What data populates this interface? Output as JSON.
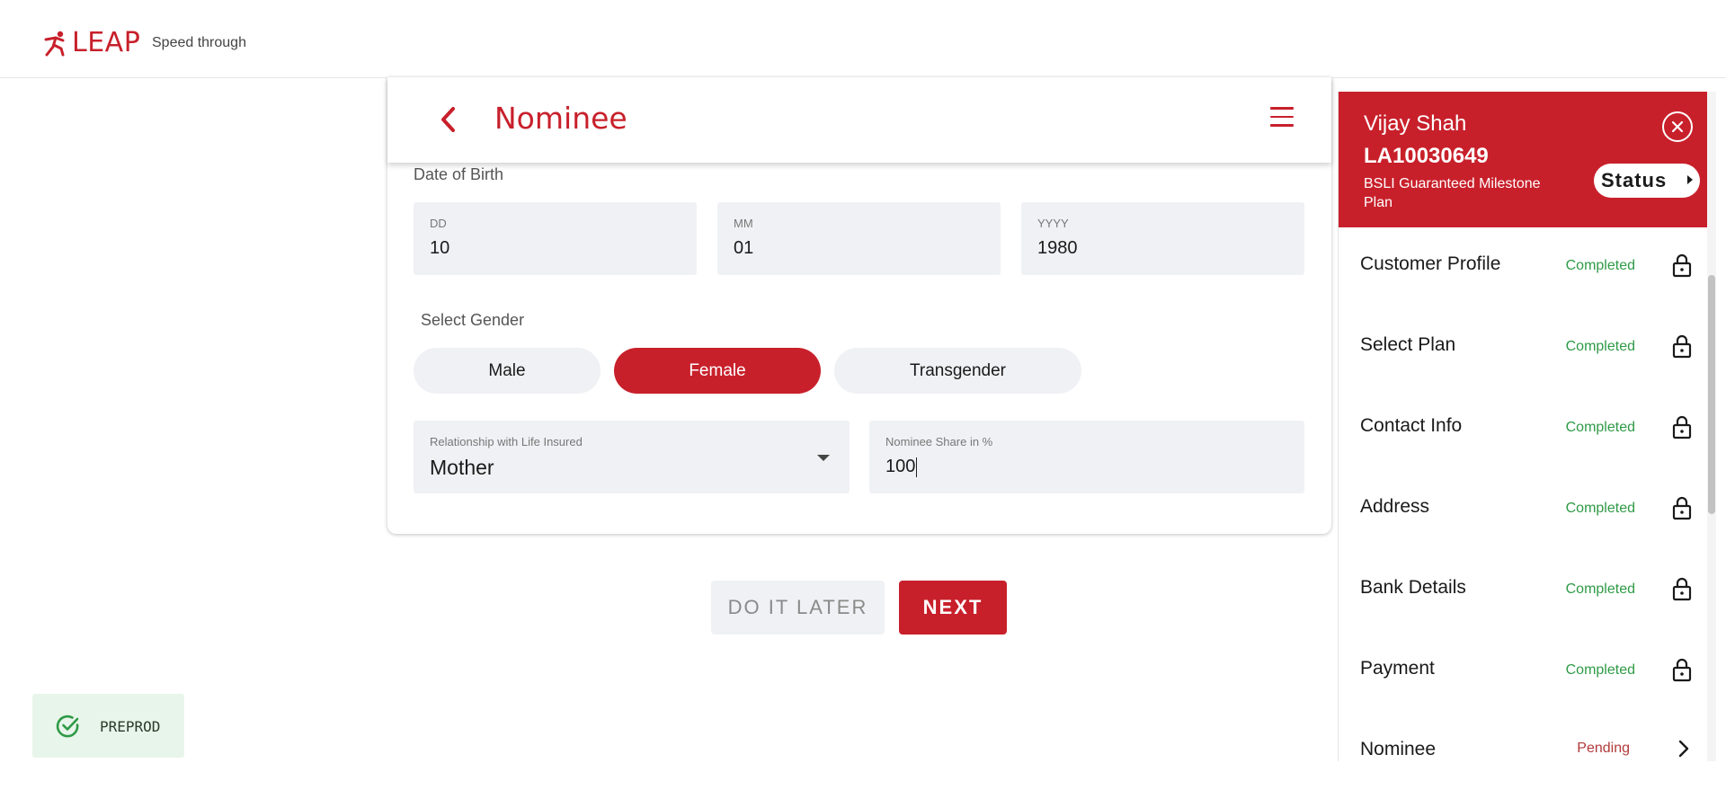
{
  "header": {
    "logo_text": "LEAP",
    "tagline": "Speed through"
  },
  "form": {
    "title": "Nominee",
    "dob_label": "Date of Birth",
    "dob": {
      "day_label": "DD",
      "day_value": "10",
      "month_label": "MM",
      "month_value": "01",
      "year_label": "YYYY",
      "year_value": "1980"
    },
    "gender_label": "Select Gender",
    "gender_options": [
      "Male",
      "Female",
      "Transgender"
    ],
    "gender_selected": "Female",
    "relationship_label": "Relationship with Life Insured",
    "relationship_value": "Mother",
    "share_label": "Nominee Share in %",
    "share_value": "100"
  },
  "actions": {
    "later_label": "DO IT LATER",
    "next_label": "NEXT"
  },
  "environment": {
    "label": "PREPROD"
  },
  "panel": {
    "customer_name": "Vijay Shah",
    "application_id": "LA10030649",
    "plan_name": "BSLI Guaranteed Milestone Plan",
    "status_button": "Status",
    "steps": [
      {
        "label": "Customer Profile",
        "status": "Completed"
      },
      {
        "label": "Select Plan",
        "status": "Completed"
      },
      {
        "label": "Contact Info",
        "status": "Completed"
      },
      {
        "label": "Address",
        "status": "Completed"
      },
      {
        "label": "Bank Details",
        "status": "Completed"
      },
      {
        "label": "Payment",
        "status": "Completed"
      },
      {
        "label": "Nominee",
        "status": "Pending"
      }
    ]
  },
  "colors": {
    "brand": "#c8202b",
    "completed": "#2e9a46",
    "pending": "#b23a3a",
    "field_bg": "#f0f1f4"
  }
}
